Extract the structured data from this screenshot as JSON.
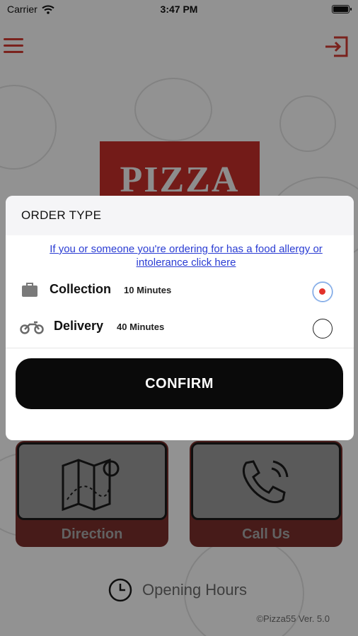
{
  "status_bar": {
    "carrier": "Carrier",
    "time": "3:47 PM"
  },
  "header": {
    "menu_icon": "hamburger-icon",
    "logout_icon": "logout-icon"
  },
  "logo": {
    "text": "PIZZA"
  },
  "modal": {
    "title": "ORDER TYPE",
    "allergy_link": "If you or someone you're ordering for has a food allergy or intolerance click here",
    "options": [
      {
        "label": "Collection",
        "time": "10 Minutes",
        "icon": "bag-icon",
        "selected": true
      },
      {
        "label": "Delivery",
        "time": "40 Minutes",
        "icon": "motorbike-icon",
        "selected": false
      }
    ],
    "confirm_label": "CONFIRM"
  },
  "tiles": {
    "direction": "Direction",
    "call_us": "Call Us"
  },
  "opening_hours": "Opening Hours",
  "version": "©Pizza55 Ver. 5.0",
  "colors": {
    "accent": "#d23c32",
    "logo_red": "#c62f2a",
    "link_blue": "#2a3cd3",
    "button_black": "#0a0a0a"
  }
}
